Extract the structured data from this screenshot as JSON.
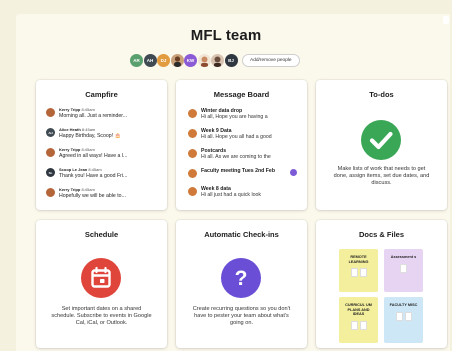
{
  "team": {
    "title": "MFL team",
    "people_button": "Add/remove people",
    "avatars": [
      {
        "initials": "AR",
        "color": "#5aa06f"
      },
      {
        "initials": "AH",
        "color": "#3f4a52"
      },
      {
        "initials": "DJ",
        "color": "#e29b3f"
      },
      {
        "initials": "",
        "color": "#c8a07a"
      },
      {
        "initials": "KW",
        "color": "#8b5bd6"
      },
      {
        "initials": "",
        "color": "#c98a62"
      },
      {
        "initials": "",
        "color": "#6a4e3d"
      },
      {
        "initials": "BJ",
        "color": "#2f3840"
      }
    ]
  },
  "campfire": {
    "title": "Campfire",
    "messages": [
      {
        "name": "Kerry Tripp",
        "time": "8:45am",
        "text": "Morning all. Just a reminder...",
        "color": "#b5653a",
        "initials": ""
      },
      {
        "name": "Alice Heath",
        "time": "8:45am",
        "text": "Happy Birthday, Scoop! 🎂",
        "color": "#3f4a52",
        "initials": "AH"
      },
      {
        "name": "Kerry Tripp",
        "time": "8:45am",
        "text": "Agreed in all ways! Have a l...",
        "color": "#b5653a",
        "initials": ""
      },
      {
        "name": "Scoop Le Jean",
        "time": "8:45am",
        "text": "Thank you! Have a good Fri...",
        "color": "#2f3840",
        "initials": "SL"
      },
      {
        "name": "Kerry Tripp",
        "time": "8:45am",
        "text": "Hopefully we will be able to...",
        "color": "#b5653a",
        "initials": ""
      }
    ]
  },
  "message_board": {
    "title": "Message Board",
    "posts": [
      {
        "title": "Winter data drop",
        "body": "Hi all, Hope you are having a"
      },
      {
        "title": "Week 9 Data",
        "body": "Hi all. Hope you all had a good"
      },
      {
        "title": "Postcards",
        "body": "Hi all. As we are coming to the"
      },
      {
        "title": "Faculty meeting Tues 2nd Feb",
        "body": ""
      },
      {
        "title": "Week 8 data",
        "body": "Hi all just had a quick look"
      }
    ]
  },
  "todos": {
    "title": "To-dos",
    "description": "Make lists of work that needs to get done, assign items, set due dates, and discuss.",
    "icon_color": "#3aa757"
  },
  "schedule": {
    "title": "Schedule",
    "description": "Set important dates on a shared schedule. Subscribe to events in Google Cal, iCal, or Outlook.",
    "icon_color": "#e0453c"
  },
  "checkins": {
    "title": "Automatic Check-ins",
    "description": "Create recurring questions so you don't have to pester your team about what's going on.",
    "icon_color": "#6a4fd6"
  },
  "docs": {
    "title": "Docs & Files",
    "folders": [
      {
        "name": "REMOTE LEARNING",
        "color": "#f4ef9c"
      },
      {
        "name": "Assessment s",
        "color": "#e6d4f2"
      },
      {
        "name": "CURRICUL UM PLANS AND IDEAS",
        "color": "#f4ef9c"
      },
      {
        "name": "FACULTY MISC",
        "color": "#cde7f6"
      }
    ]
  }
}
